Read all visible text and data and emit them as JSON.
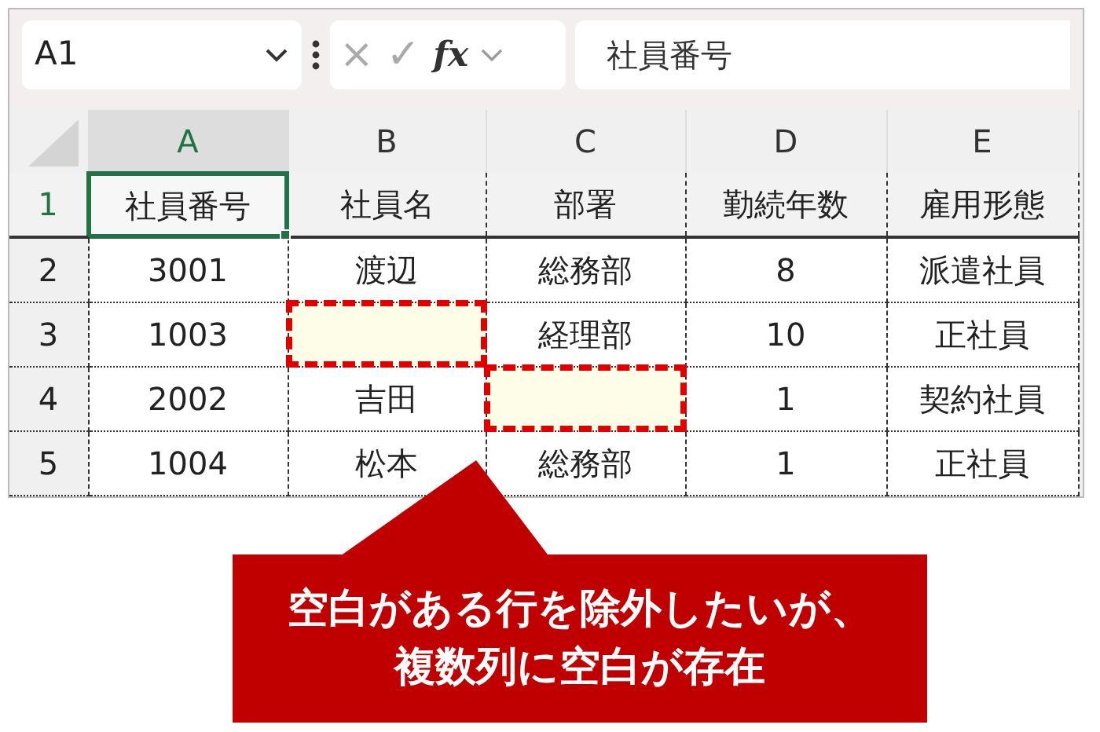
{
  "formula_bar": {
    "name_box": "A1",
    "cancel": "×",
    "enter": "✓",
    "function": "fx",
    "formula": "社員番号"
  },
  "columns": [
    {
      "label": "A",
      "selected": true
    },
    {
      "label": "B",
      "selected": false
    },
    {
      "label": "C",
      "selected": false
    },
    {
      "label": "D",
      "selected": false
    },
    {
      "label": "E",
      "selected": false
    }
  ],
  "rows": [
    {
      "number": "1",
      "selected": true,
      "cells": [
        {
          "value": "社員番号",
          "selected": true,
          "highlighted": false
        },
        {
          "value": "社員名",
          "selected": false,
          "highlighted": false
        },
        {
          "value": "部署",
          "selected": false,
          "highlighted": false
        },
        {
          "value": "勤続年数",
          "selected": false,
          "highlighted": false
        },
        {
          "value": "雇用形態",
          "selected": false,
          "highlighted": false
        }
      ]
    },
    {
      "number": "2",
      "selected": false,
      "cells": [
        {
          "value": "3001",
          "selected": false,
          "highlighted": false
        },
        {
          "value": "渡辺",
          "selected": false,
          "highlighted": false
        },
        {
          "value": "総務部",
          "selected": false,
          "highlighted": false
        },
        {
          "value": "8",
          "selected": false,
          "highlighted": false
        },
        {
          "value": "派遣社員",
          "selected": false,
          "highlighted": false
        }
      ]
    },
    {
      "number": "3",
      "selected": false,
      "cells": [
        {
          "value": "1003",
          "selected": false,
          "highlighted": false
        },
        {
          "selected": false,
          "highlighted": true
        },
        {
          "value": "経理部",
          "selected": false,
          "highlighted": false
        },
        {
          "value": "10",
          "selected": false,
          "highlighted": false
        },
        {
          "value": "正社員",
          "selected": false,
          "highlighted": false
        }
      ]
    },
    {
      "number": "4",
      "selected": false,
      "cells": [
        {
          "value": "2002",
          "selected": false,
          "highlighted": false
        },
        {
          "value": "吉田",
          "selected": false,
          "highlighted": false
        },
        {
          "selected": false,
          "highlighted": true
        },
        {
          "value": "1",
          "selected": false,
          "highlighted": false
        },
        {
          "value": "契約社員",
          "selected": false,
          "highlighted": false
        }
      ]
    },
    {
      "number": "5",
      "selected": false,
      "cells": [
        {
          "value": "1004",
          "selected": false,
          "highlighted": false
        },
        {
          "value": "松本",
          "selected": false,
          "highlighted": false
        },
        {
          "value": "総務部",
          "selected": false,
          "highlighted": false
        },
        {
          "value": "1",
          "selected": false,
          "highlighted": false
        },
        {
          "value": "正社員",
          "selected": false,
          "highlighted": false
        }
      ]
    }
  ],
  "callout": {
    "lines": [
      "空白がある行を除外したいが、",
      "複数列に空白が存在"
    ]
  }
}
